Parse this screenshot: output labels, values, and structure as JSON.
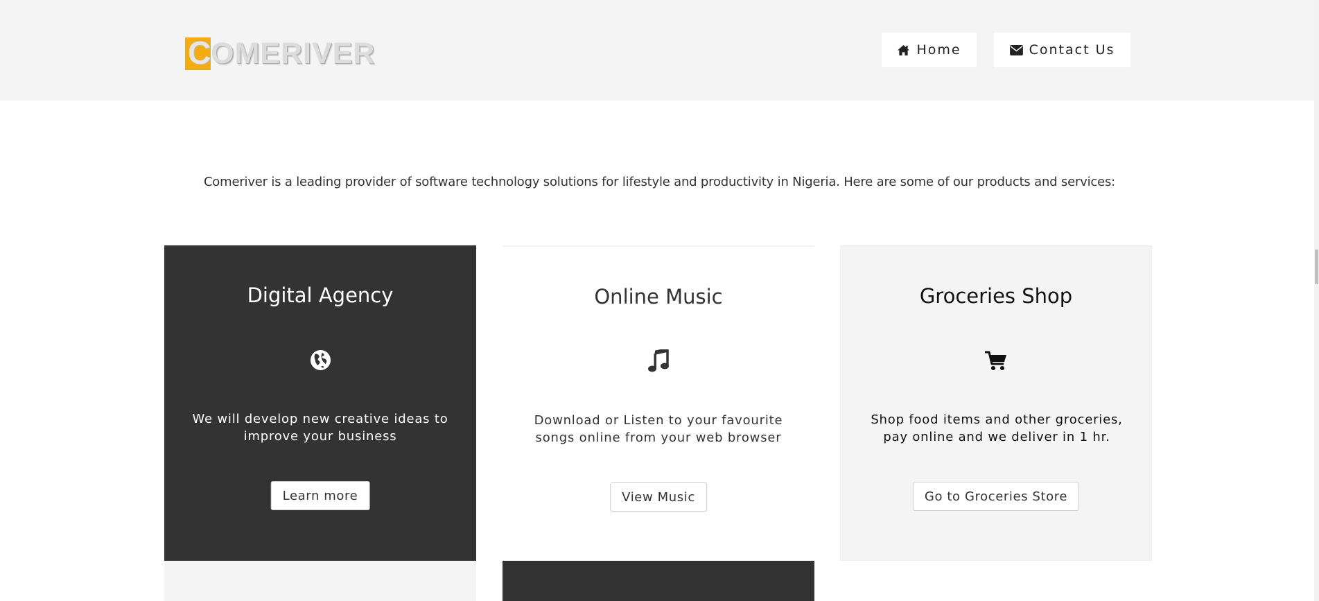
{
  "header": {
    "logo": {
      "first_letter": "C",
      "rest": "OMERIVER"
    },
    "nav": [
      {
        "label": "Home",
        "icon": "home-icon"
      },
      {
        "label": "Contact Us",
        "icon": "envelope-icon"
      }
    ]
  },
  "intro": "Comeriver is a leading provider of software technology solutions for lifestyle and productivity in Nigeria. Here are some of our products and services:",
  "cards": [
    {
      "title": "Digital Agency",
      "icon": "globe-icon",
      "description": "We will develop new creative ideas to improve your business",
      "button": "Learn more"
    },
    {
      "title": "Online Music",
      "icon": "music-note-icon",
      "description": "Download or Listen to your favourite songs online from your web browser",
      "button": "View Music"
    },
    {
      "title": "Groceries Shop",
      "icon": "shopping-cart-icon",
      "description": "Shop food items and other groceries, pay online and we deliver in 1 hr.",
      "button": "Go to Groceries Store"
    }
  ],
  "colors": {
    "logo_accent": "#f3ac12",
    "header_bg": "#f4f4f4",
    "dark_card": "#333333",
    "light_card": "#f4f4f4"
  }
}
